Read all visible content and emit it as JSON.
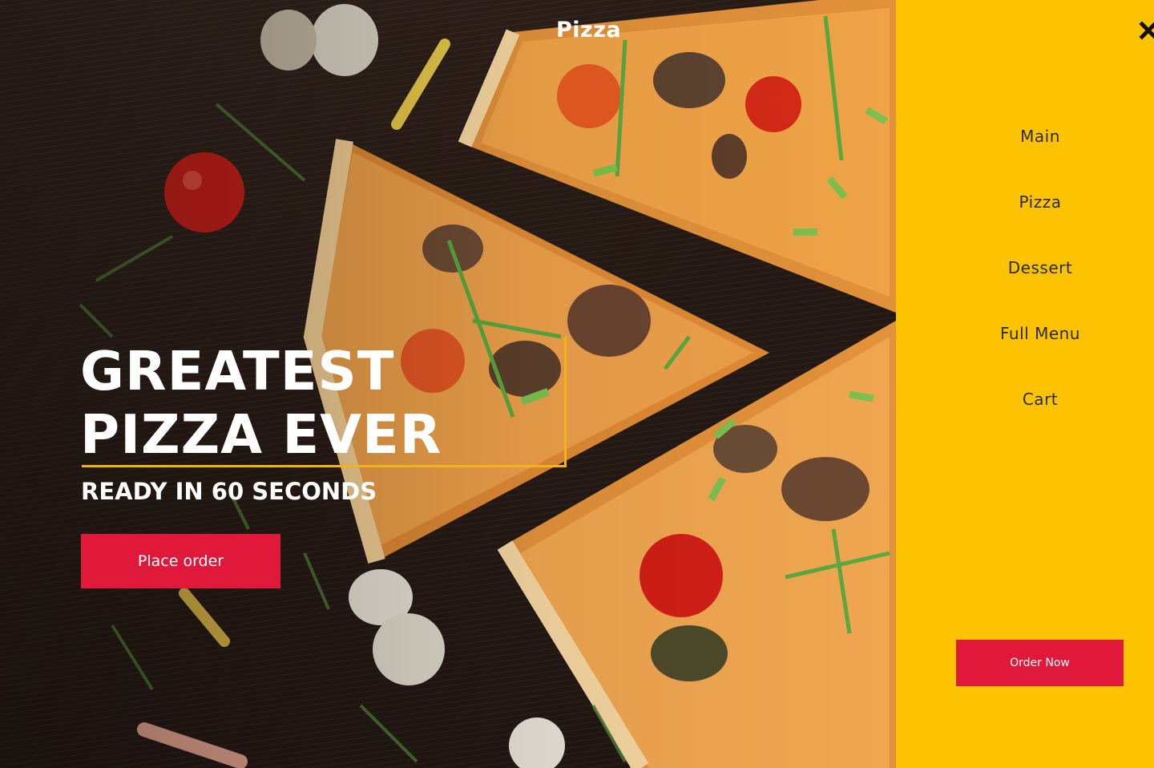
{
  "header": {
    "brand": "Pizza"
  },
  "hero": {
    "headline_line1": "GREATEST",
    "headline_line2": "PIZZA EVER",
    "subheadline": "READY IN 60 SECONDS",
    "cta_label": "Place order"
  },
  "side_menu": {
    "items": [
      {
        "label": "Main"
      },
      {
        "label": "Pizza"
      },
      {
        "label": "Dessert"
      },
      {
        "label": "Full Menu"
      },
      {
        "label": "Cart"
      }
    ],
    "order_button_label": "Order Now",
    "close_icon": "close-icon"
  },
  "colors": {
    "panel_background": "#fec300",
    "button_red": "#e0193b",
    "headline_border": "#f2b319",
    "text_white": "#ffffff"
  }
}
